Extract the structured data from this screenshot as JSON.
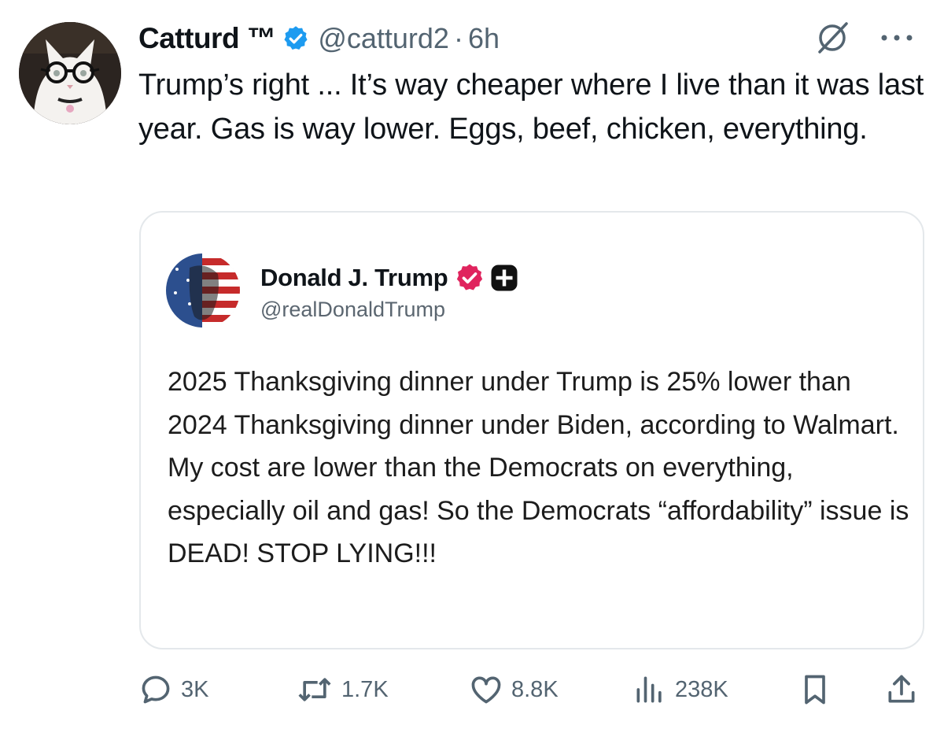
{
  "tweet": {
    "author_name": "Catturd ™",
    "handle": "@catturd2",
    "separator": "·",
    "time": "6h",
    "text": "Trump’s right ... It’s way cheaper where I live than it was last year. Gas is way lower. Eggs, beef, chicken, everything.",
    "verified_color": "#1d9bf0",
    "icons": {
      "grok": "grok-icon",
      "more": "more-dots-icon"
    }
  },
  "quote": {
    "author_name": "Donald J. Trump",
    "handle": "@realDonaldTrump",
    "badge_color": "#e0245e",
    "text": "2025 Thanksgiving dinner under Trump is 25% lower than 2024 Thanksgiving dinner under Biden, according to Walmart. My cost are lower than the Democrats on everything, especially oil and gas! So the Democrats “affordability” issue is DEAD! STOP LYING!!!"
  },
  "actions": {
    "replies": "3K",
    "reposts": "1.7K",
    "likes": "8.8K",
    "views": "238K",
    "icons": [
      "reply-icon",
      "repost-icon",
      "like-icon",
      "views-icon",
      "bookmark-icon",
      "share-icon"
    ]
  }
}
